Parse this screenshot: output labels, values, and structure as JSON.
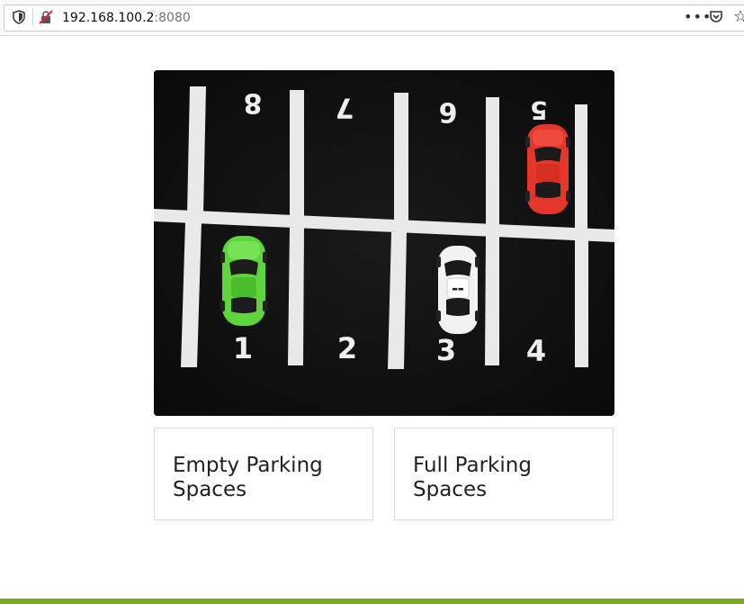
{
  "browser": {
    "url_host": "192.168.100.2",
    "url_port": ":8080",
    "menu_label": "•••"
  },
  "parking_image": {
    "alt": "Parking lot with numbered spaces",
    "space_numbers_top": [
      "8",
      "7",
      "6",
      "5"
    ],
    "space_numbers_bottom": [
      "1",
      "2",
      "3",
      "4"
    ],
    "car_colors": {
      "green": "#5fd43c",
      "white": "#f2f2f2",
      "red": "#e5362a"
    }
  },
  "cards": {
    "empty_label": "Empty Parking Spaces",
    "full_label": "Full Parking Spaces"
  },
  "theme": {
    "accent": "#79a72a"
  }
}
